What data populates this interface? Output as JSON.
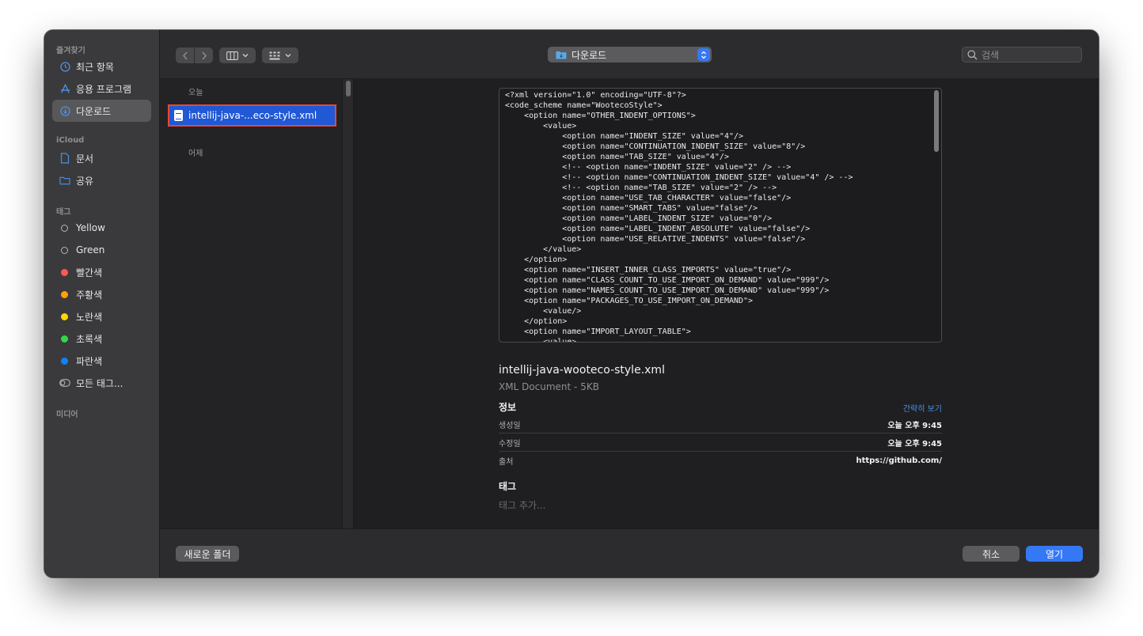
{
  "sidebar": {
    "favorites_label": "즐겨찾기",
    "favorites": [
      {
        "label": "최근 항목",
        "icon": "clock-icon"
      },
      {
        "label": "응용 프로그램",
        "icon": "applications-icon"
      },
      {
        "label": "다운로드",
        "icon": "download-icon",
        "active": true
      }
    ],
    "icloud_label": "iCloud",
    "icloud": [
      {
        "label": "문서",
        "icon": "document-icon"
      },
      {
        "label": "공유",
        "icon": "shared-folder-icon"
      }
    ],
    "tags_label": "태그",
    "tags": [
      {
        "label": "Yellow",
        "color": "hollow"
      },
      {
        "label": "Green",
        "color": "hollow"
      },
      {
        "label": "빨간색",
        "color": "#ff5a52"
      },
      {
        "label": "주황색",
        "color": "#ff9f0a"
      },
      {
        "label": "노란색",
        "color": "#ffd60a"
      },
      {
        "label": "초록색",
        "color": "#32d74b"
      },
      {
        "label": "파란색",
        "color": "#0a84ff"
      },
      {
        "label": "모든 태그...",
        "icon": "all-tags-icon"
      }
    ],
    "media_label": "미디어"
  },
  "toolbar": {
    "back_icon": "chevron-left-icon",
    "forward_icon": "chevron-right-icon",
    "view_icon": "column-view-icon",
    "group_icon": "grid-view-icon",
    "location": "다운로드",
    "search_placeholder": "검색"
  },
  "file_list": {
    "today_label": "오늘",
    "selected_file": "intellij-java-...eco-style.xml",
    "yesterday_label": "어제"
  },
  "preview": {
    "code": "<?xml version=\"1.0\" encoding=\"UTF-8\"?>\n<code_scheme name=\"WootecoStyle\">\n    <option name=\"OTHER_INDENT_OPTIONS\">\n        <value>\n            <option name=\"INDENT_SIZE\" value=\"4\"/>\n            <option name=\"CONTINUATION_INDENT_SIZE\" value=\"8\"/>\n            <option name=\"TAB_SIZE\" value=\"4\"/>\n            <!-- <option name=\"INDENT_SIZE\" value=\"2\" /> -->\n            <!-- <option name=\"CONTINUATION_INDENT_SIZE\" value=\"4\" /> -->\n            <!-- <option name=\"TAB_SIZE\" value=\"2\" /> -->\n            <option name=\"USE_TAB_CHARACTER\" value=\"false\"/>\n            <option name=\"SMART_TABS\" value=\"false\"/>\n            <option name=\"LABEL_INDENT_SIZE\" value=\"0\"/>\n            <option name=\"LABEL_INDENT_ABSOLUTE\" value=\"false\"/>\n            <option name=\"USE_RELATIVE_INDENTS\" value=\"false\"/>\n        </value>\n    </option>\n    <option name=\"INSERT_INNER_CLASS_IMPORTS\" value=\"true\"/>\n    <option name=\"CLASS_COUNT_TO_USE_IMPORT_ON_DEMAND\" value=\"999\"/>\n    <option name=\"NAMES_COUNT_TO_USE_IMPORT_ON_DEMAND\" value=\"999\"/>\n    <option name=\"PACKAGES_TO_USE_IMPORT_ON_DEMAND\">\n        <value/>\n    </option>\n    <option name=\"IMPORT_LAYOUT_TABLE\">\n        <value>",
    "file_name": "intellij-java-wooteco-style.xml",
    "file_kind": "XML Document - 5KB",
    "info_title": "정보",
    "show_less": "간략히 보기",
    "created_label": "생성일",
    "created_value": "오늘 오후 9:45",
    "modified_label": "수정일",
    "modified_value": "오늘 오후 9:45",
    "source_label": "출처",
    "source_value": "https://github.com/",
    "tags_title": "태그",
    "add_tags_placeholder": "태그 추가..."
  },
  "bottom": {
    "new_folder": "새로운 폴더",
    "cancel": "취소",
    "open": "열기"
  }
}
